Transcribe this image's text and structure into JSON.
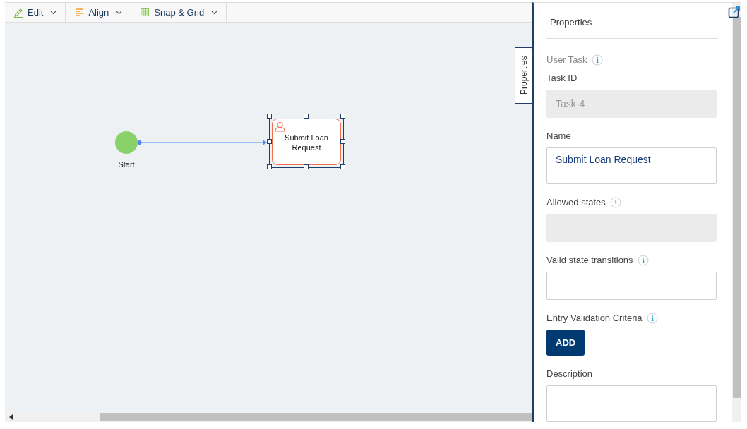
{
  "toolbar": [
    {
      "label": "Edit"
    },
    {
      "label": "Align"
    },
    {
      "label": "Snap & Grid"
    }
  ],
  "diagram": {
    "nodes": [
      {
        "kind": "start",
        "label": "Start",
        "selected": false
      },
      {
        "kind": "user_task",
        "label": "Submit Loan Request",
        "selected": true
      }
    ]
  },
  "side_tab": {
    "label": "Properties"
  },
  "panel": {
    "title": "Properties",
    "section": "User Task",
    "fields": [
      {
        "kind": "input",
        "label": "Task ID",
        "value": "Task-4",
        "info": false,
        "disabled": true
      },
      {
        "kind": "textarea",
        "label": "Name",
        "value": "Submit Loan Request",
        "info": false,
        "disabled": false
      },
      {
        "kind": "input",
        "label": "Allowed states",
        "info": true,
        "disabled": true
      },
      {
        "kind": "input",
        "label": "Valid state transitions",
        "info": true,
        "disabled": false
      },
      {
        "kind": "button",
        "label": "Entry Validation Criteria",
        "info": true,
        "button": "ADD"
      },
      {
        "kind": "textarea",
        "label": "Description",
        "info": false,
        "disabled": false
      }
    ]
  }
}
